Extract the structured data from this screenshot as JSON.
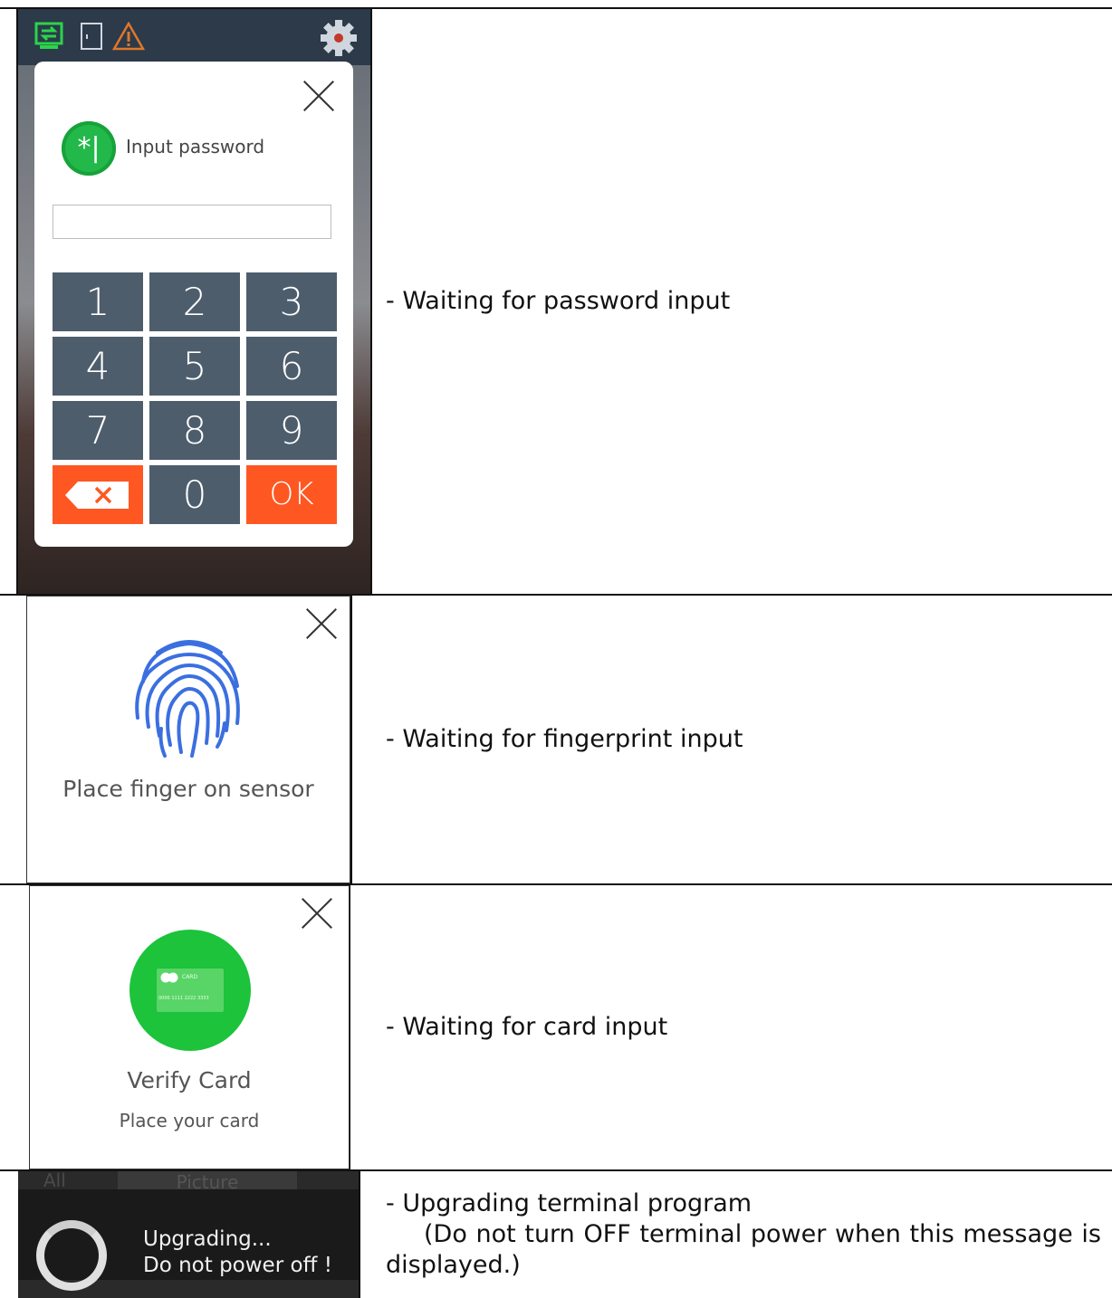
{
  "panels": [
    {
      "description": "- Waiting for password input",
      "dialog": {
        "label": "Input password",
        "icon": "password-asterisk-icon",
        "keys": [
          "1",
          "2",
          "3",
          "4",
          "5",
          "6",
          "7",
          "8",
          "9",
          "",
          "0",
          "OK"
        ]
      }
    },
    {
      "description": "- Waiting for fingerprint input",
      "dialog": {
        "label": "Place finger on sensor",
        "icon": "fingerprint-icon"
      }
    },
    {
      "description": "- Waiting for card input",
      "dialog": {
        "title": "Verify Card",
        "subtitle": "Place your card",
        "icon": "card-icon",
        "card_brand": "CARD",
        "card_number": "0000 1111 2222 3333"
      }
    },
    {
      "description_line1": "- Upgrading terminal program",
      "description_line2": "(Do not turn OFF terminal power when this message is displayed.)",
      "dialog": {
        "line1": "Upgrading...",
        "line2": "Do not power off !",
        "tab1": "All",
        "tab2": "Picture"
      }
    }
  ],
  "colors": {
    "keypad_key": "#4d5d6c",
    "keypad_action": "#ff5722",
    "accent_green": "#1cc33b",
    "fingerprint_blue": "#3b6fe0"
  }
}
